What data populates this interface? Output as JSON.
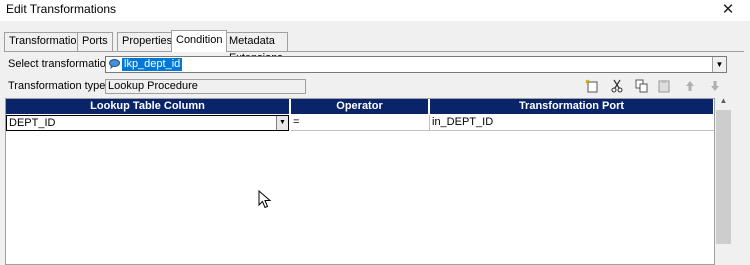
{
  "window": {
    "title": "Edit Transformations",
    "close_label": "✕"
  },
  "tabs": [
    {
      "label": "Transformation"
    },
    {
      "label": "Ports"
    },
    {
      "label": "Properties"
    },
    {
      "label": "Condition",
      "active": true
    },
    {
      "label": "Metadata Extensions"
    }
  ],
  "select_transformation": {
    "label": "Select transformation:",
    "value": "lkp_dept_id"
  },
  "transformation_type": {
    "label": "Transformation type:",
    "value": "Lookup Procedure"
  },
  "toolbar": [
    "new-icon",
    "cut-icon",
    "copy-icon",
    "paste-icon",
    "move-up-icon",
    "move-down-icon"
  ],
  "grid": {
    "columns": [
      "Lookup Table Column",
      "Operator",
      "Transformation Port"
    ],
    "rows": [
      {
        "lookup_column": "DEPT_ID",
        "operator": "=",
        "port": "in_DEPT_ID"
      }
    ]
  },
  "colors": {
    "header_bg": "#0a246a",
    "selection": "#0078d7",
    "dialog_bg": "#f0f0f0"
  }
}
